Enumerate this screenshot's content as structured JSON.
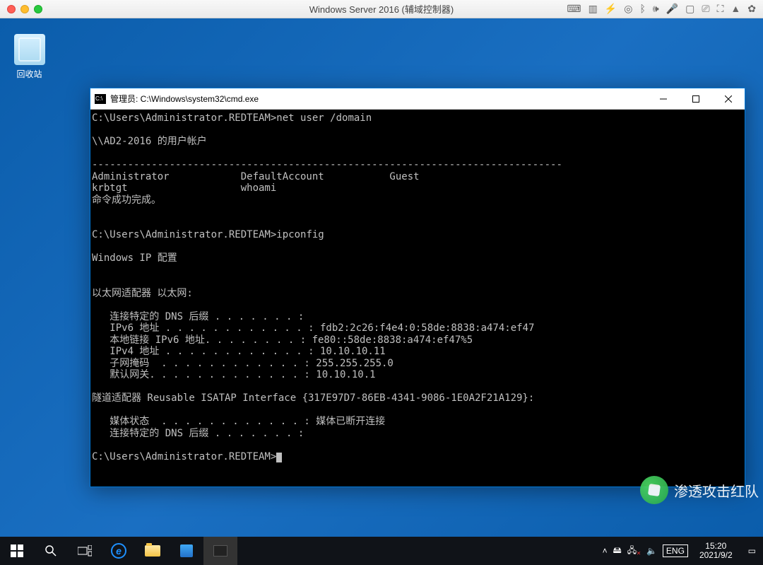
{
  "mac_title": "Windows Server 2016 (辅域控制器)",
  "recycle_label": "回收站",
  "cmd_title": "管理员: C:\\Windows\\system32\\cmd.exe",
  "terminal": {
    "prompt1": "C:\\Users\\Administrator.REDTEAM>",
    "cmd1": "net user /domain",
    "line1": "",
    "line2": "\\\\AD2-2016 的用户帐户",
    "line3": "",
    "dash": "-------------------------------------------------------------------------------",
    "row1": "Administrator            DefaultAccount           Guest",
    "row2": "krbtgt                   whoami",
    "done": "命令成功完成。",
    "blank": "",
    "prompt2": "C:\\Users\\Administrator.REDTEAM>",
    "cmd2": "ipconfig",
    "ip_title": "Windows IP 配置",
    "adapter1": "以太网适配器 以太网:",
    "ad1_l1": "   连接特定的 DNS 后缀 . . . . . . . :",
    "ad1_l2": "   IPv6 地址 . . . . . . . . . . . . : fdb2:2c26:f4e4:0:58de:8838:a474:ef47",
    "ad1_l3": "   本地链接 IPv6 地址. . . . . . . . : fe80::58de:8838:a474:ef47%5",
    "ad1_l4": "   IPv4 地址 . . . . . . . . . . . . : 10.10.10.11",
    "ad1_l5": "   子网掩码  . . . . . . . . . . . . : 255.255.255.0",
    "ad1_l6": "   默认网关. . . . . . . . . . . . . : 10.10.10.1",
    "tunnel": "隧道适配器 Reusable ISATAP Interface {317E97D7-86EB-4341-9086-1E0A2F21A129}:",
    "tn_l1": "   媒体状态  . . . . . . . . . . . . : 媒体已断开连接",
    "tn_l2": "   连接特定的 DNS 后缀 . . . . . . . :",
    "prompt3": "C:\\Users\\Administrator.REDTEAM>"
  },
  "tray": {
    "chevron": "˄",
    "battery": "🖴",
    "net": "📶",
    "netx": "×",
    "vol": "🔈",
    "ime": "ENG",
    "time": "15:20",
    "date": "2021/9/2"
  },
  "watermark_text": "渗透攻击红队"
}
